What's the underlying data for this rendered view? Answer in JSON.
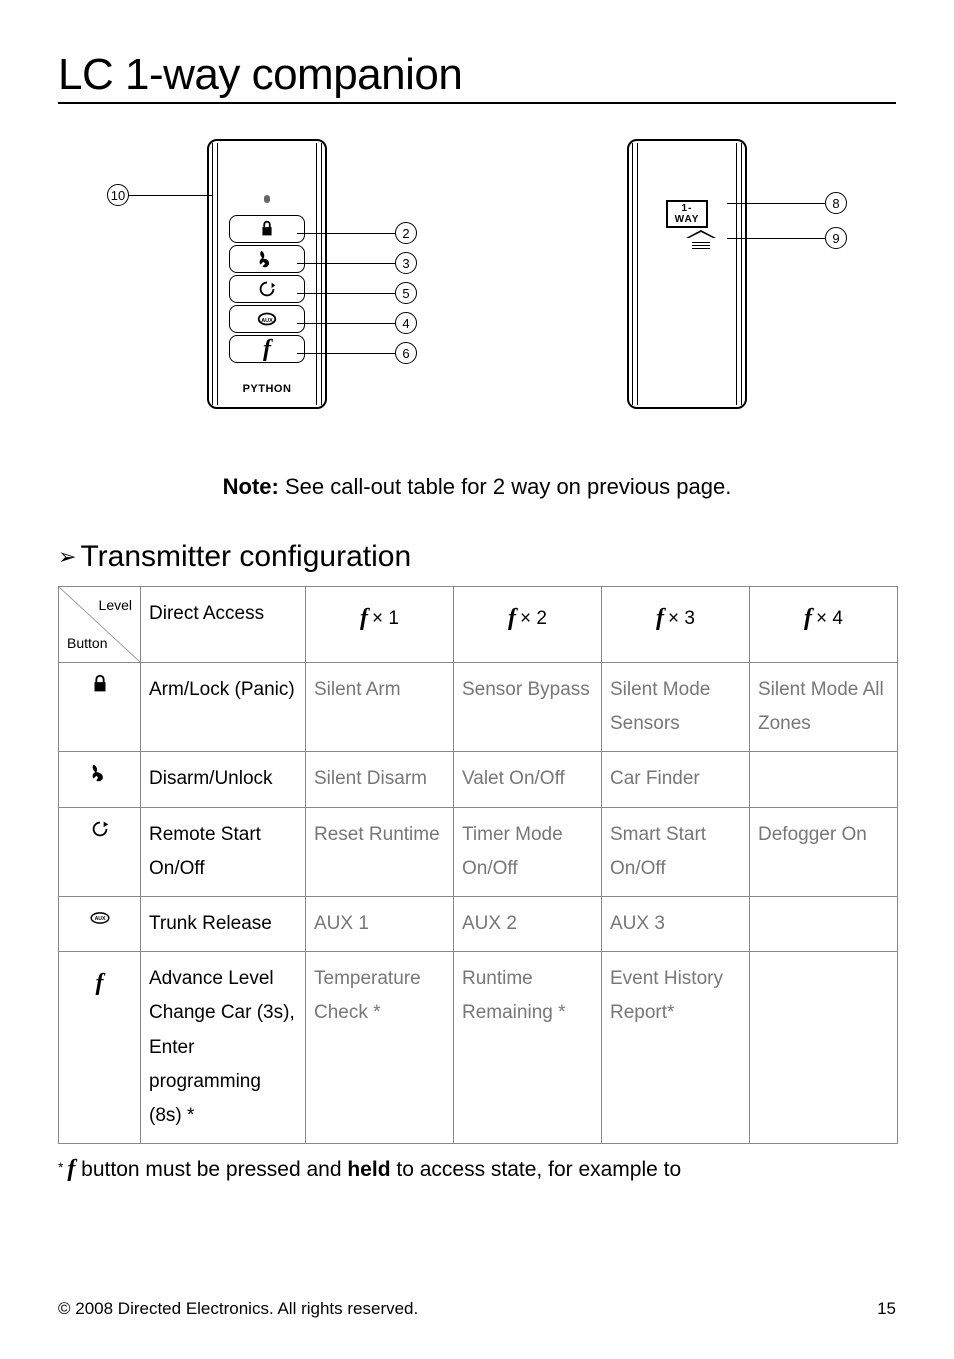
{
  "title": "LC 1-way companion",
  "diagram": {
    "front": {
      "callouts_left": [
        {
          "n": "10"
        }
      ],
      "callouts_right": [
        {
          "n": "2"
        },
        {
          "n": "3"
        },
        {
          "n": "5"
        },
        {
          "n": "4"
        },
        {
          "n": "6"
        }
      ],
      "brand": "PYTHON"
    },
    "back": {
      "label": "1-WAY",
      "callouts_right": [
        {
          "n": "8"
        },
        {
          "n": "9"
        }
      ]
    }
  },
  "note": {
    "bold": "Note:",
    "text": " See call-out table for 2 way on previous page."
  },
  "section_heading": "Transmitter configuration",
  "table": {
    "head_diag": {
      "top": "Level",
      "bottom": "Button"
    },
    "head_cols": [
      "Direct Access",
      "× 1",
      "× 2",
      "× 3",
      "× 4"
    ],
    "rows": [
      {
        "icon": "lock",
        "cells": [
          "Arm/Lock (Panic)",
          "Silent Arm",
          "Sensor Bypass",
          "Silent Mode Sensors",
          "Silent Mode All Zones"
        ],
        "gray_from": 1
      },
      {
        "icon": "unlock",
        "cells": [
          "Disarm/Unlock",
          "Silent Disarm",
          "Valet On/Off",
          "Car Finder",
          ""
        ],
        "gray_from": 1
      },
      {
        "icon": "start",
        "cells": [
          "Remote Start On/Off",
          "Reset Runtime",
          "Timer Mode On/Off",
          "Smart Start On/Off",
          "Defogger On"
        ],
        "gray_from": 1
      },
      {
        "icon": "aux",
        "cells": [
          "Trunk Release",
          "AUX 1",
          "AUX 2",
          "AUX 3",
          ""
        ],
        "gray_from": 1
      },
      {
        "icon": "f",
        "cells": [
          "Advance Level Change Car (3s), Enter programming (8s) *",
          "Temperature Check *",
          "Runtime Remaining *",
          "Event History Report*",
          ""
        ],
        "gray_from": 1
      }
    ]
  },
  "footnote": {
    "pre": "* ",
    "mid": " button must be pressed and ",
    "bold": "held",
    "post": " to access state, for example to"
  },
  "footer": {
    "copyright": "© 2008 Directed Electronics. All rights reserved.",
    "page": "15"
  }
}
